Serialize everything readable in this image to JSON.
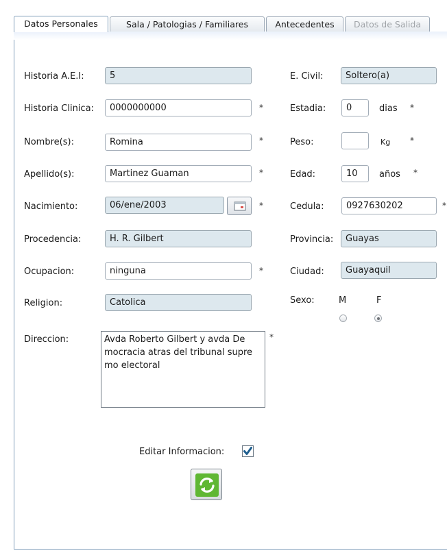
{
  "tabs": [
    {
      "label": "Datos Personales",
      "state": "active"
    },
    {
      "label": "Sala / Patologias / Familiares",
      "state": "normal"
    },
    {
      "label": "Antecedentes",
      "state": "normal"
    },
    {
      "label": "Datos de Salida",
      "state": "disabled"
    }
  ],
  "form": {
    "historia_aei": {
      "label": "Historia A.E.I:",
      "value": "5"
    },
    "historia_clinica": {
      "label": "Historia Clinica:",
      "value": "0000000000",
      "required": "*"
    },
    "nombre": {
      "label": "Nombre(s):",
      "value": "Romina",
      "required": "*"
    },
    "apellido": {
      "label": "Apellido(s):",
      "value": "Martinez Guaman",
      "required": "*"
    },
    "nacimiento": {
      "label": "Nacimiento:",
      "value": "06/ene/2003",
      "required": "*",
      "button_icon": "calendar-icon"
    },
    "procedencia": {
      "label": "Procedencia:",
      "value": "H. R. Gilbert"
    },
    "ocupacion": {
      "label": "Ocupacion:",
      "value": "ninguna",
      "required": "*"
    },
    "religion": {
      "label": "Religion:",
      "value": "Catolica"
    },
    "direccion": {
      "label": "Direccion:",
      "lines": [
        "Avda Roberto Gilbert y avda De",
        "mocracia atras del tribunal supre",
        "mo electoral"
      ],
      "required": "*"
    },
    "estado_civil": {
      "label": "E. Civil:",
      "value": "Soltero(a)"
    },
    "estadia": {
      "label": "Estadia:",
      "value": "0",
      "unit": "dias",
      "required": "*"
    },
    "peso": {
      "label": "Peso:",
      "value": "",
      "unit": "Kg",
      "required": "*"
    },
    "edad": {
      "label": "Edad:",
      "value": "10",
      "unit": "años",
      "required": "*"
    },
    "cedula": {
      "label": "Cedula:",
      "value": "0927630202",
      "required": "*"
    },
    "provincia": {
      "label": "Provincia:",
      "value": "Guayas"
    },
    "ciudad": {
      "label": "Ciudad:",
      "value": "Guayaquil"
    },
    "sexo": {
      "label": "Sexo:",
      "option_m": "M",
      "option_f": "F",
      "selected": "F"
    }
  },
  "editar": {
    "label": "Editar Informacion:",
    "checked": true
  },
  "refresh_button": {
    "icon": "refresh-icon"
  },
  "colors": {
    "readonly_bg": "#dde8ee",
    "tab_border": "#7f9db9",
    "check": "#1f5f8f",
    "refresh_green": "#4aa02c"
  }
}
